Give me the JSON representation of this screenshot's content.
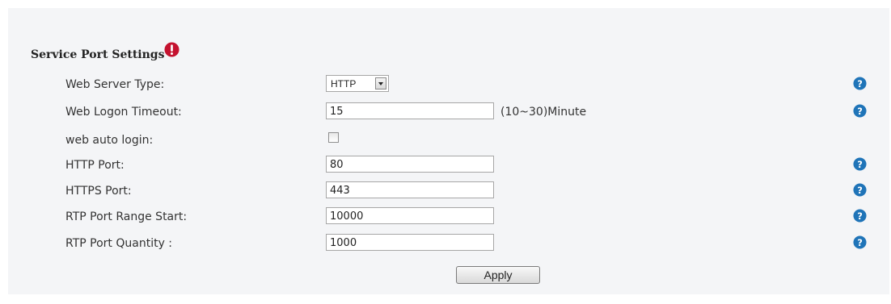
{
  "section": {
    "title": "Service Port Settings"
  },
  "fields": {
    "web_server_type": {
      "label": "Web Server Type:",
      "value": "HTTP"
    },
    "web_logon_timeout": {
      "label": "Web Logon Timeout:",
      "value": "15",
      "suffix": "(10~30)Minute"
    },
    "web_auto_login": {
      "label": "web auto login:",
      "checked": false
    },
    "http_port": {
      "label": "HTTP Port:",
      "value": "80"
    },
    "https_port": {
      "label": "HTTPS Port:",
      "value": "443"
    },
    "rtp_port_range_start": {
      "label": "RTP Port Range Start:",
      "value": "10000"
    },
    "rtp_port_quantity": {
      "label": "RTP Port Quantity :",
      "value": "1000"
    }
  },
  "actions": {
    "apply_label": "Apply"
  },
  "colors": {
    "help_icon": "#1f74b8",
    "alert_icon": "#c4122f",
    "panel_bg": "#f4f5f7"
  },
  "icons": {
    "help": "question-circle-icon",
    "alert": "exclamation-circle-icon"
  }
}
